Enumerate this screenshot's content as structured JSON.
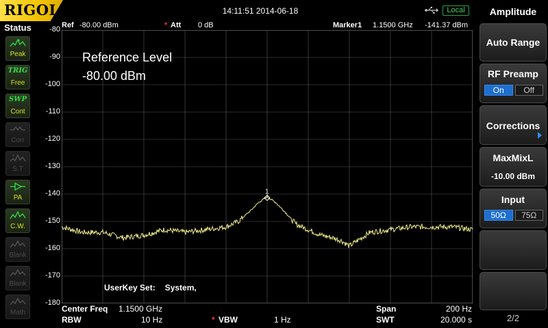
{
  "topbar": {
    "brand": "RIGOL",
    "datetime": "14:11:51 2014-06-18",
    "remote_status": "Local",
    "usb_icon": "usb-icon"
  },
  "status": {
    "title": "Status",
    "items": [
      {
        "icon": "peak-icon",
        "label": "Peak",
        "active": true
      },
      {
        "icon": "trig-icon",
        "icon_text": "TRIG",
        "label": "Free",
        "active": true
      },
      {
        "icon": "swp-icon",
        "icon_text": "SWP",
        "label": "Cont",
        "active": true
      },
      {
        "icon": "corr-icon",
        "label": "Corr",
        "active": false
      },
      {
        "icon": "st-icon",
        "label": "S.T",
        "active": false
      },
      {
        "icon": "pa-icon",
        "label": "PA",
        "active": true
      },
      {
        "icon": "cw-icon",
        "label": "C.W.",
        "active": true
      },
      {
        "icon": "blank-icon",
        "label": "Blank",
        "active": false
      },
      {
        "icon": "blank-icon",
        "label": "Blank",
        "active": false
      },
      {
        "icon": "math-icon",
        "label": "Math",
        "active": false
      }
    ]
  },
  "plot_header": {
    "ref_label": "Ref",
    "ref_value": "-80.00 dBm",
    "att_label": "Att",
    "att_value": "0 dB",
    "marker_label": "Marker1",
    "marker_freq": "1.1500 GHz",
    "marker_level": "-141.37 dBm"
  },
  "overlay": {
    "ref_level_title": "Reference Level",
    "ref_level_value": "-80.00 dBm",
    "userkey_label": "UserKey Set:",
    "userkey_value": "System,"
  },
  "bottom": {
    "center_label": "Center Freq",
    "center_value": "1.1500 GHz",
    "span_label": "Span",
    "span_value": "200 Hz",
    "rbw_label": "RBW",
    "rbw_value": "10 Hz",
    "vbw_label": "VBW",
    "vbw_value": "1 Hz",
    "swt_label": "SWT",
    "swt_value": "20.000 s"
  },
  "chart_data": {
    "type": "line",
    "ylim": [
      -180,
      -80
    ],
    "yticks": [
      "-80",
      "-90",
      "-100",
      "-110",
      "-120",
      "-130",
      "-140",
      "-150",
      "-160",
      "-170",
      "-180"
    ],
    "x_divisions": 10,
    "marker": {
      "label": "1",
      "x_fraction": 0.5,
      "y": -141.37
    },
    "series": [
      {
        "color": "#f2ee8a",
        "x_fraction": [
          0,
          0.05,
          0.1,
          0.15,
          0.2,
          0.25,
          0.3,
          0.35,
          0.4,
          0.43,
          0.46,
          0.48,
          0.5,
          0.52,
          0.54,
          0.57,
          0.6,
          0.63,
          0.66,
          0.68,
          0.7,
          0.75,
          0.8,
          0.85,
          0.9,
          0.95,
          1.0
        ],
        "y": [
          -152,
          -154,
          -154,
          -156,
          -155,
          -153,
          -154,
          -153,
          -152,
          -150,
          -146,
          -143,
          -141,
          -143,
          -146,
          -151,
          -153,
          -155,
          -156,
          -157,
          -159,
          -154,
          -153,
          -152,
          -152,
          -152,
          -153
        ]
      }
    ]
  },
  "menu": {
    "title": "Amplitude",
    "auto_range": "Auto Range",
    "rf_preamp": "RF Preamp",
    "rf_on": "On",
    "rf_off": "Off",
    "corrections": "Corrections",
    "maxmixl": "MaxMixL",
    "maxmixl_value": "-10.00 dBm",
    "input": "Input",
    "input_50": "50Ω",
    "input_75": "75Ω",
    "page": "2/2"
  }
}
